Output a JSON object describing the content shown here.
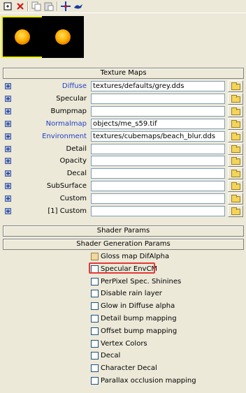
{
  "toolbar": {
    "buttons": [
      {
        "name": "new-icon"
      },
      {
        "name": "delete-icon"
      },
      {
        "name": "copy-icon"
      },
      {
        "name": "paste-icon"
      },
      {
        "name": "move-icon"
      },
      {
        "name": "bird-icon"
      }
    ]
  },
  "swatches": [
    {
      "name": "material-swatch-1",
      "selected": true
    },
    {
      "name": "material-swatch-2",
      "selected": false
    }
  ],
  "texture_maps": {
    "title": "Texture Maps",
    "rows": [
      {
        "label": "Diffuse",
        "value": "textures/defaults/grey.dds",
        "link": true
      },
      {
        "label": "Specular",
        "value": "",
        "link": false
      },
      {
        "label": "Bumpmap",
        "value": "",
        "link": false
      },
      {
        "label": "Normalmap",
        "value": "objects/me_s59.tif",
        "link": true
      },
      {
        "label": "Environment",
        "value": "textures/cubemaps/beach_blur.dds",
        "link": true
      },
      {
        "label": "Detail",
        "value": "",
        "link": false
      },
      {
        "label": "Opacity",
        "value": "",
        "link": false
      },
      {
        "label": "Decal",
        "value": "",
        "link": false
      },
      {
        "label": "SubSurface",
        "value": "",
        "link": false
      },
      {
        "label": "Custom",
        "value": "",
        "link": false
      },
      {
        "label": "[1] Custom",
        "value": "",
        "link": false
      }
    ]
  },
  "shader_params": {
    "title": "Shader Params"
  },
  "shader_generation": {
    "title": "Shader Generation Params",
    "options": [
      {
        "label": "Gloss map DifAlpha",
        "style": "filled"
      },
      {
        "label": "Specular EnvCM",
        "style": "plain",
        "highlighted": true
      },
      {
        "label": "PerPixel Spec. Shinines",
        "style": "plain"
      },
      {
        "label": "Disable rain layer",
        "style": "plain"
      },
      {
        "label": "Glow in Diffuse alpha",
        "style": "plain"
      },
      {
        "label": "Detail bump mapping",
        "style": "plain"
      },
      {
        "label": "Offset bump mapping",
        "style": "plain"
      },
      {
        "label": "Vertex Colors",
        "style": "plain"
      },
      {
        "label": "Decal",
        "style": "plain"
      },
      {
        "label": "Character Decal",
        "style": "plain"
      },
      {
        "label": "Parallax occlusion mapping",
        "style": "plain"
      }
    ]
  },
  "colors": {
    "link": "#2140c8",
    "highlight": "#e53935",
    "panel_bg": "#ece9d8"
  }
}
